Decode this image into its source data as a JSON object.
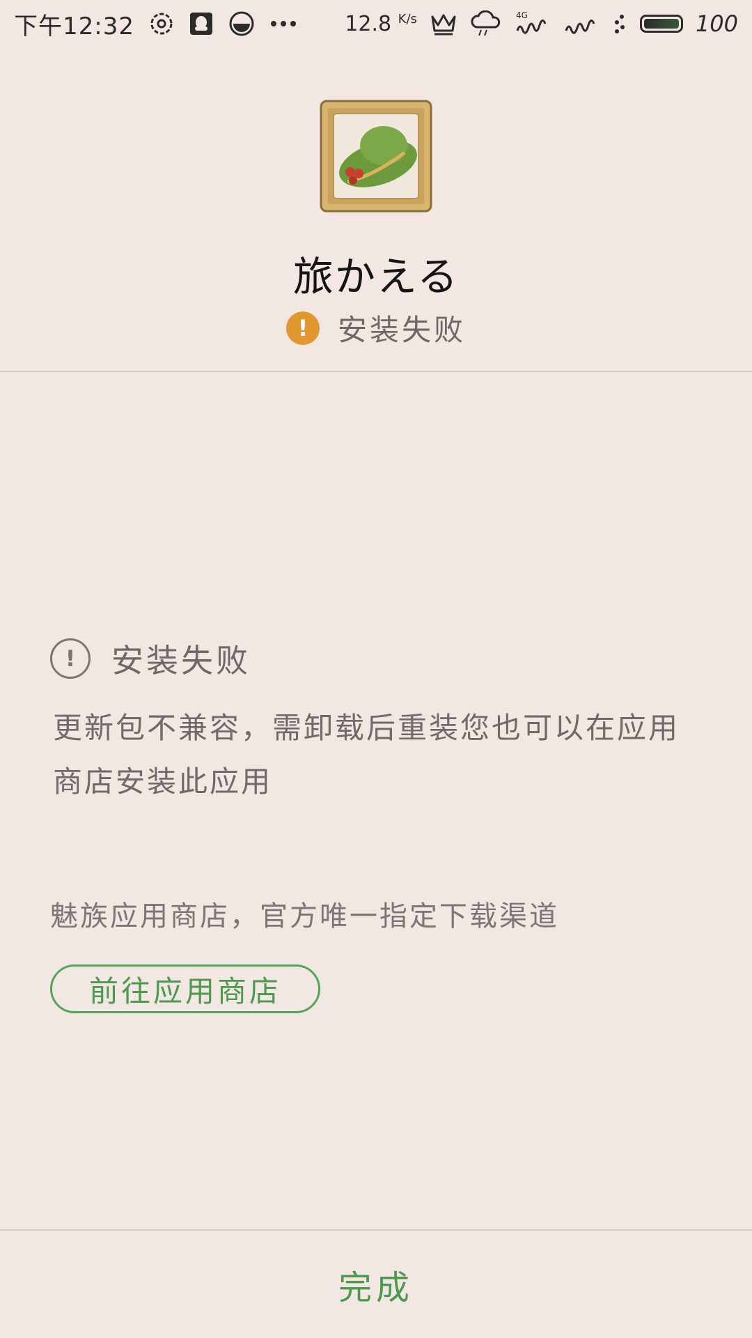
{
  "status_bar": {
    "time": "下午12:32",
    "speed_value": "12.8",
    "speed_unit": "K/s",
    "network_label": "4G",
    "battery": "100",
    "icons": [
      "settings-flower-icon",
      "qq-icon",
      "circle-app-icon",
      "more-dots-icon",
      "crown-icon",
      "rain-cloud-icon",
      "signal-4g-icon",
      "signal-icon",
      "dots-icon",
      "battery-icon"
    ]
  },
  "app": {
    "name": "旅かえる",
    "icon": "frog-hat-app-icon",
    "install_status": "安装失败"
  },
  "error": {
    "title": "安装失败",
    "description": "更新包不兼容，需卸载后重装您也可以在应用商店安装此应用"
  },
  "store": {
    "note": "魅族应用商店，官方唯一指定下载渠道",
    "button_label": "前往应用商店"
  },
  "footer": {
    "done_label": "完成"
  },
  "colors": {
    "background": "#f2e7e3",
    "warning_orange": "#e3982f",
    "accent_green": "#4c9a50",
    "divider": "#d2c8c5"
  }
}
